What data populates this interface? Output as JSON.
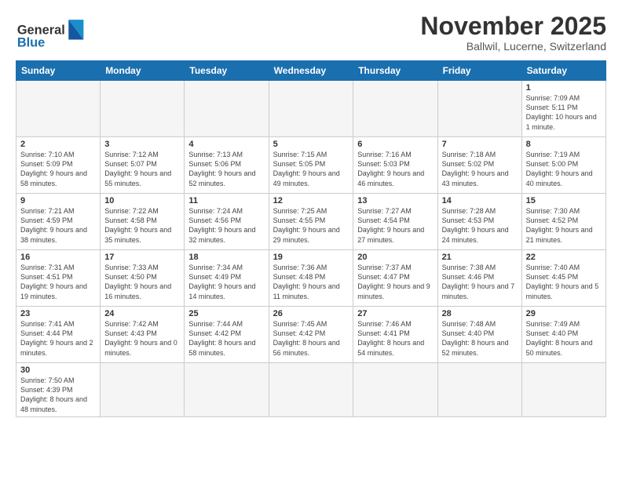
{
  "header": {
    "logo_general": "General",
    "logo_blue": "Blue",
    "month": "November 2025",
    "location": "Ballwil, Lucerne, Switzerland"
  },
  "days_of_week": [
    "Sunday",
    "Monday",
    "Tuesday",
    "Wednesday",
    "Thursday",
    "Friday",
    "Saturday"
  ],
  "weeks": [
    [
      {
        "day": "",
        "info": ""
      },
      {
        "day": "",
        "info": ""
      },
      {
        "day": "",
        "info": ""
      },
      {
        "day": "",
        "info": ""
      },
      {
        "day": "",
        "info": ""
      },
      {
        "day": "",
        "info": ""
      },
      {
        "day": "1",
        "info": "Sunrise: 7:09 AM\nSunset: 5:11 PM\nDaylight: 10 hours and 1 minute."
      }
    ],
    [
      {
        "day": "2",
        "info": "Sunrise: 7:10 AM\nSunset: 5:09 PM\nDaylight: 9 hours and 58 minutes."
      },
      {
        "day": "3",
        "info": "Sunrise: 7:12 AM\nSunset: 5:07 PM\nDaylight: 9 hours and 55 minutes."
      },
      {
        "day": "4",
        "info": "Sunrise: 7:13 AM\nSunset: 5:06 PM\nDaylight: 9 hours and 52 minutes."
      },
      {
        "day": "5",
        "info": "Sunrise: 7:15 AM\nSunset: 5:05 PM\nDaylight: 9 hours and 49 minutes."
      },
      {
        "day": "6",
        "info": "Sunrise: 7:16 AM\nSunset: 5:03 PM\nDaylight: 9 hours and 46 minutes."
      },
      {
        "day": "7",
        "info": "Sunrise: 7:18 AM\nSunset: 5:02 PM\nDaylight: 9 hours and 43 minutes."
      },
      {
        "day": "8",
        "info": "Sunrise: 7:19 AM\nSunset: 5:00 PM\nDaylight: 9 hours and 40 minutes."
      }
    ],
    [
      {
        "day": "9",
        "info": "Sunrise: 7:21 AM\nSunset: 4:59 PM\nDaylight: 9 hours and 38 minutes."
      },
      {
        "day": "10",
        "info": "Sunrise: 7:22 AM\nSunset: 4:58 PM\nDaylight: 9 hours and 35 minutes."
      },
      {
        "day": "11",
        "info": "Sunrise: 7:24 AM\nSunset: 4:56 PM\nDaylight: 9 hours and 32 minutes."
      },
      {
        "day": "12",
        "info": "Sunrise: 7:25 AM\nSunset: 4:55 PM\nDaylight: 9 hours and 29 minutes."
      },
      {
        "day": "13",
        "info": "Sunrise: 7:27 AM\nSunset: 4:54 PM\nDaylight: 9 hours and 27 minutes."
      },
      {
        "day": "14",
        "info": "Sunrise: 7:28 AM\nSunset: 4:53 PM\nDaylight: 9 hours and 24 minutes."
      },
      {
        "day": "15",
        "info": "Sunrise: 7:30 AM\nSunset: 4:52 PM\nDaylight: 9 hours and 21 minutes."
      }
    ],
    [
      {
        "day": "16",
        "info": "Sunrise: 7:31 AM\nSunset: 4:51 PM\nDaylight: 9 hours and 19 minutes."
      },
      {
        "day": "17",
        "info": "Sunrise: 7:33 AM\nSunset: 4:50 PM\nDaylight: 9 hours and 16 minutes."
      },
      {
        "day": "18",
        "info": "Sunrise: 7:34 AM\nSunset: 4:49 PM\nDaylight: 9 hours and 14 minutes."
      },
      {
        "day": "19",
        "info": "Sunrise: 7:36 AM\nSunset: 4:48 PM\nDaylight: 9 hours and 11 minutes."
      },
      {
        "day": "20",
        "info": "Sunrise: 7:37 AM\nSunset: 4:47 PM\nDaylight: 9 hours and 9 minutes."
      },
      {
        "day": "21",
        "info": "Sunrise: 7:38 AM\nSunset: 4:46 PM\nDaylight: 9 hours and 7 minutes."
      },
      {
        "day": "22",
        "info": "Sunrise: 7:40 AM\nSunset: 4:45 PM\nDaylight: 9 hours and 5 minutes."
      }
    ],
    [
      {
        "day": "23",
        "info": "Sunrise: 7:41 AM\nSunset: 4:44 PM\nDaylight: 9 hours and 2 minutes."
      },
      {
        "day": "24",
        "info": "Sunrise: 7:42 AM\nSunset: 4:43 PM\nDaylight: 9 hours and 0 minutes."
      },
      {
        "day": "25",
        "info": "Sunrise: 7:44 AM\nSunset: 4:42 PM\nDaylight: 8 hours and 58 minutes."
      },
      {
        "day": "26",
        "info": "Sunrise: 7:45 AM\nSunset: 4:42 PM\nDaylight: 8 hours and 56 minutes."
      },
      {
        "day": "27",
        "info": "Sunrise: 7:46 AM\nSunset: 4:41 PM\nDaylight: 8 hours and 54 minutes."
      },
      {
        "day": "28",
        "info": "Sunrise: 7:48 AM\nSunset: 4:40 PM\nDaylight: 8 hours and 52 minutes."
      },
      {
        "day": "29",
        "info": "Sunrise: 7:49 AM\nSunset: 4:40 PM\nDaylight: 8 hours and 50 minutes."
      }
    ],
    [
      {
        "day": "30",
        "info": "Sunrise: 7:50 AM\nSunset: 4:39 PM\nDaylight: 8 hours and 48 minutes."
      },
      {
        "day": "",
        "info": ""
      },
      {
        "day": "",
        "info": ""
      },
      {
        "day": "",
        "info": ""
      },
      {
        "day": "",
        "info": ""
      },
      {
        "day": "",
        "info": ""
      },
      {
        "day": "",
        "info": ""
      }
    ]
  ]
}
